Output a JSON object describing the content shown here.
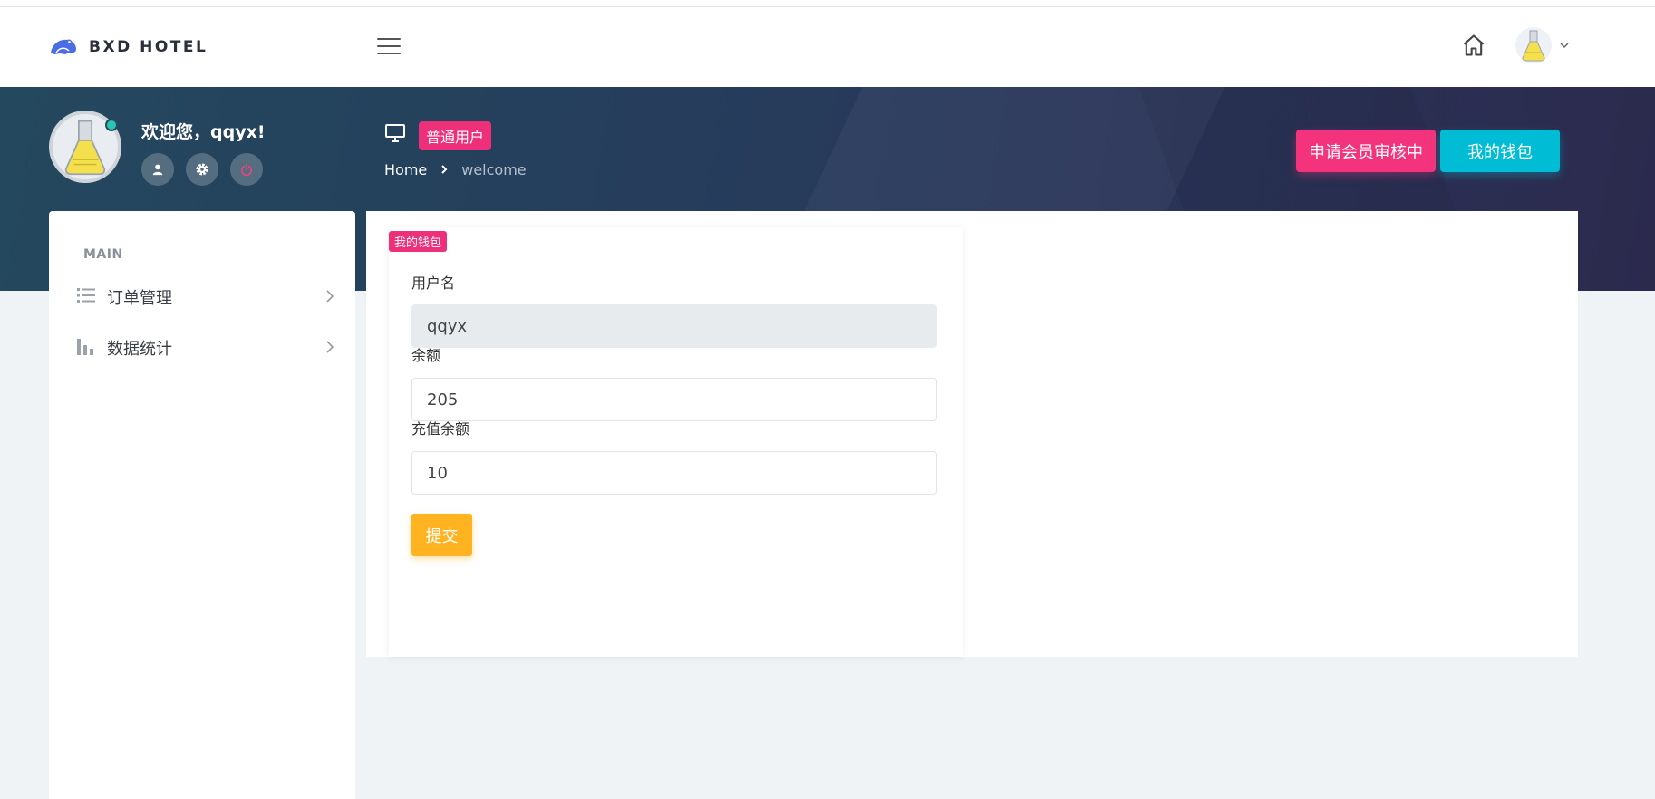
{
  "brand": {
    "name": "BXD HOTEL"
  },
  "user": {
    "greeting": "欢迎您，qqyx!",
    "role_badge": "普通用户"
  },
  "breadcrumb": {
    "home": "Home",
    "current": "welcome"
  },
  "actions": {
    "apply_member": "申请会员审核中",
    "my_wallet": "我的钱包"
  },
  "sidebar": {
    "section_title": "MAIN",
    "items": [
      {
        "label": "订单管理",
        "icon": "list-icon"
      },
      {
        "label": "数据统计",
        "icon": "bar-chart-icon"
      }
    ]
  },
  "wallet_form": {
    "badge": "我的钱包",
    "username_label": "用户名",
    "username_value": "qqyx",
    "balance_label": "余额",
    "balance_value": "205",
    "recharge_label": "充值余额",
    "recharge_value": "10",
    "submit_label": "提交"
  },
  "colors": {
    "accent_pink": "#ee2f7a",
    "accent_cyan": "#00bcd4",
    "accent_yellow": "#ffb321",
    "online": "#26c6b0"
  }
}
